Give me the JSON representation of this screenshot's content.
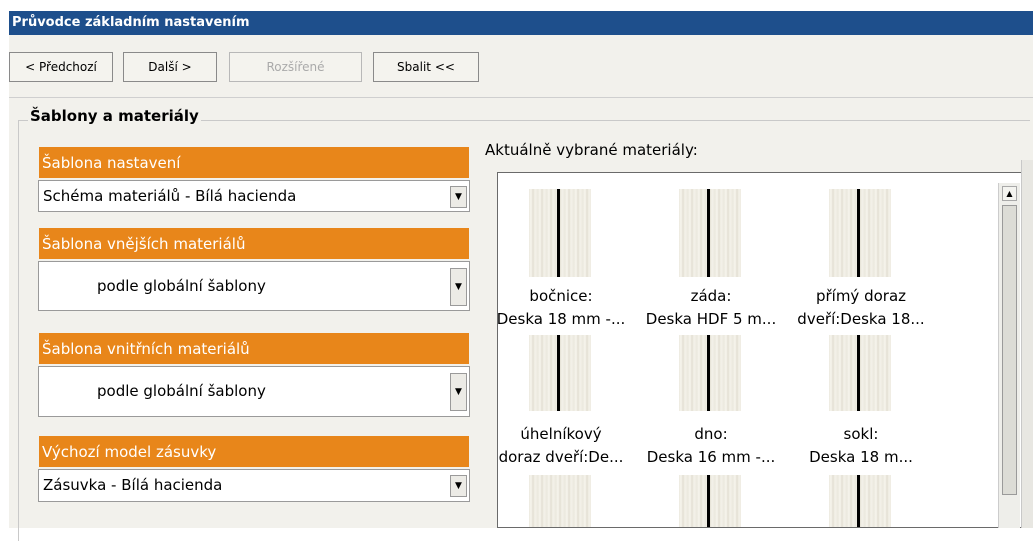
{
  "window": {
    "title": "Průvodce základním nastavením"
  },
  "toolbar": {
    "prev_label": "< Předchozí",
    "next_label": "Další >",
    "advanced_label": "Rozšířené",
    "collapse_label": "Sbalit <<"
  },
  "group": {
    "title": "Šablony a materiály"
  },
  "settings_template": {
    "label": "Šablona nastavení",
    "value": "Schéma materiálů - Bílá hacienda"
  },
  "outer_materials": {
    "label": "Šablona vnějších materiálů",
    "value": "podle globální šablony"
  },
  "inner_materials": {
    "label": "Šablona vnitřních materiálů",
    "value": "podle globální šablony"
  },
  "drawer_model": {
    "label": "Výchozí model zásuvky",
    "value": "Zásuvka - Bílá hacienda"
  },
  "materials_panel": {
    "label": "Aktuálně vybrané materiály:",
    "items": [
      {
        "line1": "bočnice:",
        "line2": "Deska 18 mm -..."
      },
      {
        "line1": "záda:",
        "line2": "Deska HDF 5 m..."
      },
      {
        "line1": "přímý doraz",
        "line2": "dveří:Deska 18..."
      },
      {
        "line1": "úhelníkový",
        "line2": "doraz dveří:De..."
      },
      {
        "line1": "dno:",
        "line2": "Deska 16 mm -..."
      },
      {
        "line1": "sokl:",
        "line2": "Deska 18 m..."
      }
    ]
  },
  "colors": {
    "title_bar": "#1e4f8c",
    "section_header": "#e8861a",
    "background": "#f2f1ec"
  },
  "icons": {
    "dropdown": "chevron-down-icon",
    "scroll_up": "arrow-up-icon"
  }
}
